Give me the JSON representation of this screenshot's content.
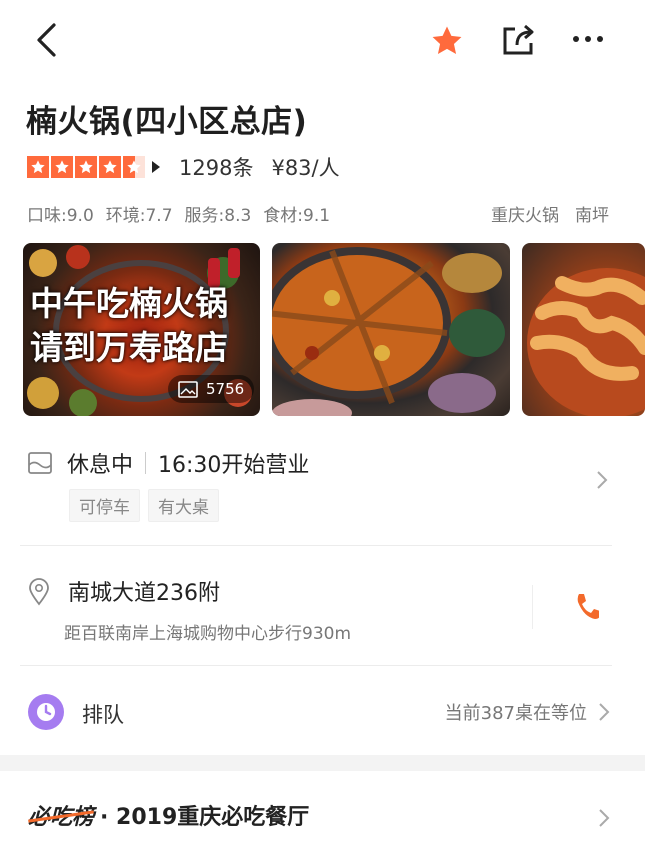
{
  "header": {
    "back_icon": "chevron-left-icon",
    "favorite_icon": "star-icon",
    "share_icon": "share-icon",
    "more_icon": "more-icon",
    "accent_color": "#ff6a3c"
  },
  "restaurant": {
    "name": "楠火锅(四小区总店)",
    "rating_stars": 4.5,
    "review_count": "1298条",
    "avg_price": "¥83/人",
    "scores": [
      "口味:9.0",
      "环境:7.7",
      "服务:8.3",
      "食材:9.1"
    ],
    "category": "重庆火锅",
    "area": "南坪"
  },
  "photos": {
    "overlay_line1": "中午吃楠火锅",
    "overlay_line2": "请到万寿路店",
    "count": "5756"
  },
  "hours": {
    "status": "休息中",
    "open_time": "16:30开始营业",
    "amenities": [
      "可停车",
      "有大桌"
    ]
  },
  "address": {
    "street": "南城大道236附",
    "distance": "距百联南岸上海城购物中心步行930m"
  },
  "queue": {
    "label": "排队",
    "status": "当前387桌在等位",
    "icon_color": "#a57cf0"
  },
  "ranking": {
    "brand": "必吃榜",
    "title": "· 2019重庆必吃餐厅"
  }
}
